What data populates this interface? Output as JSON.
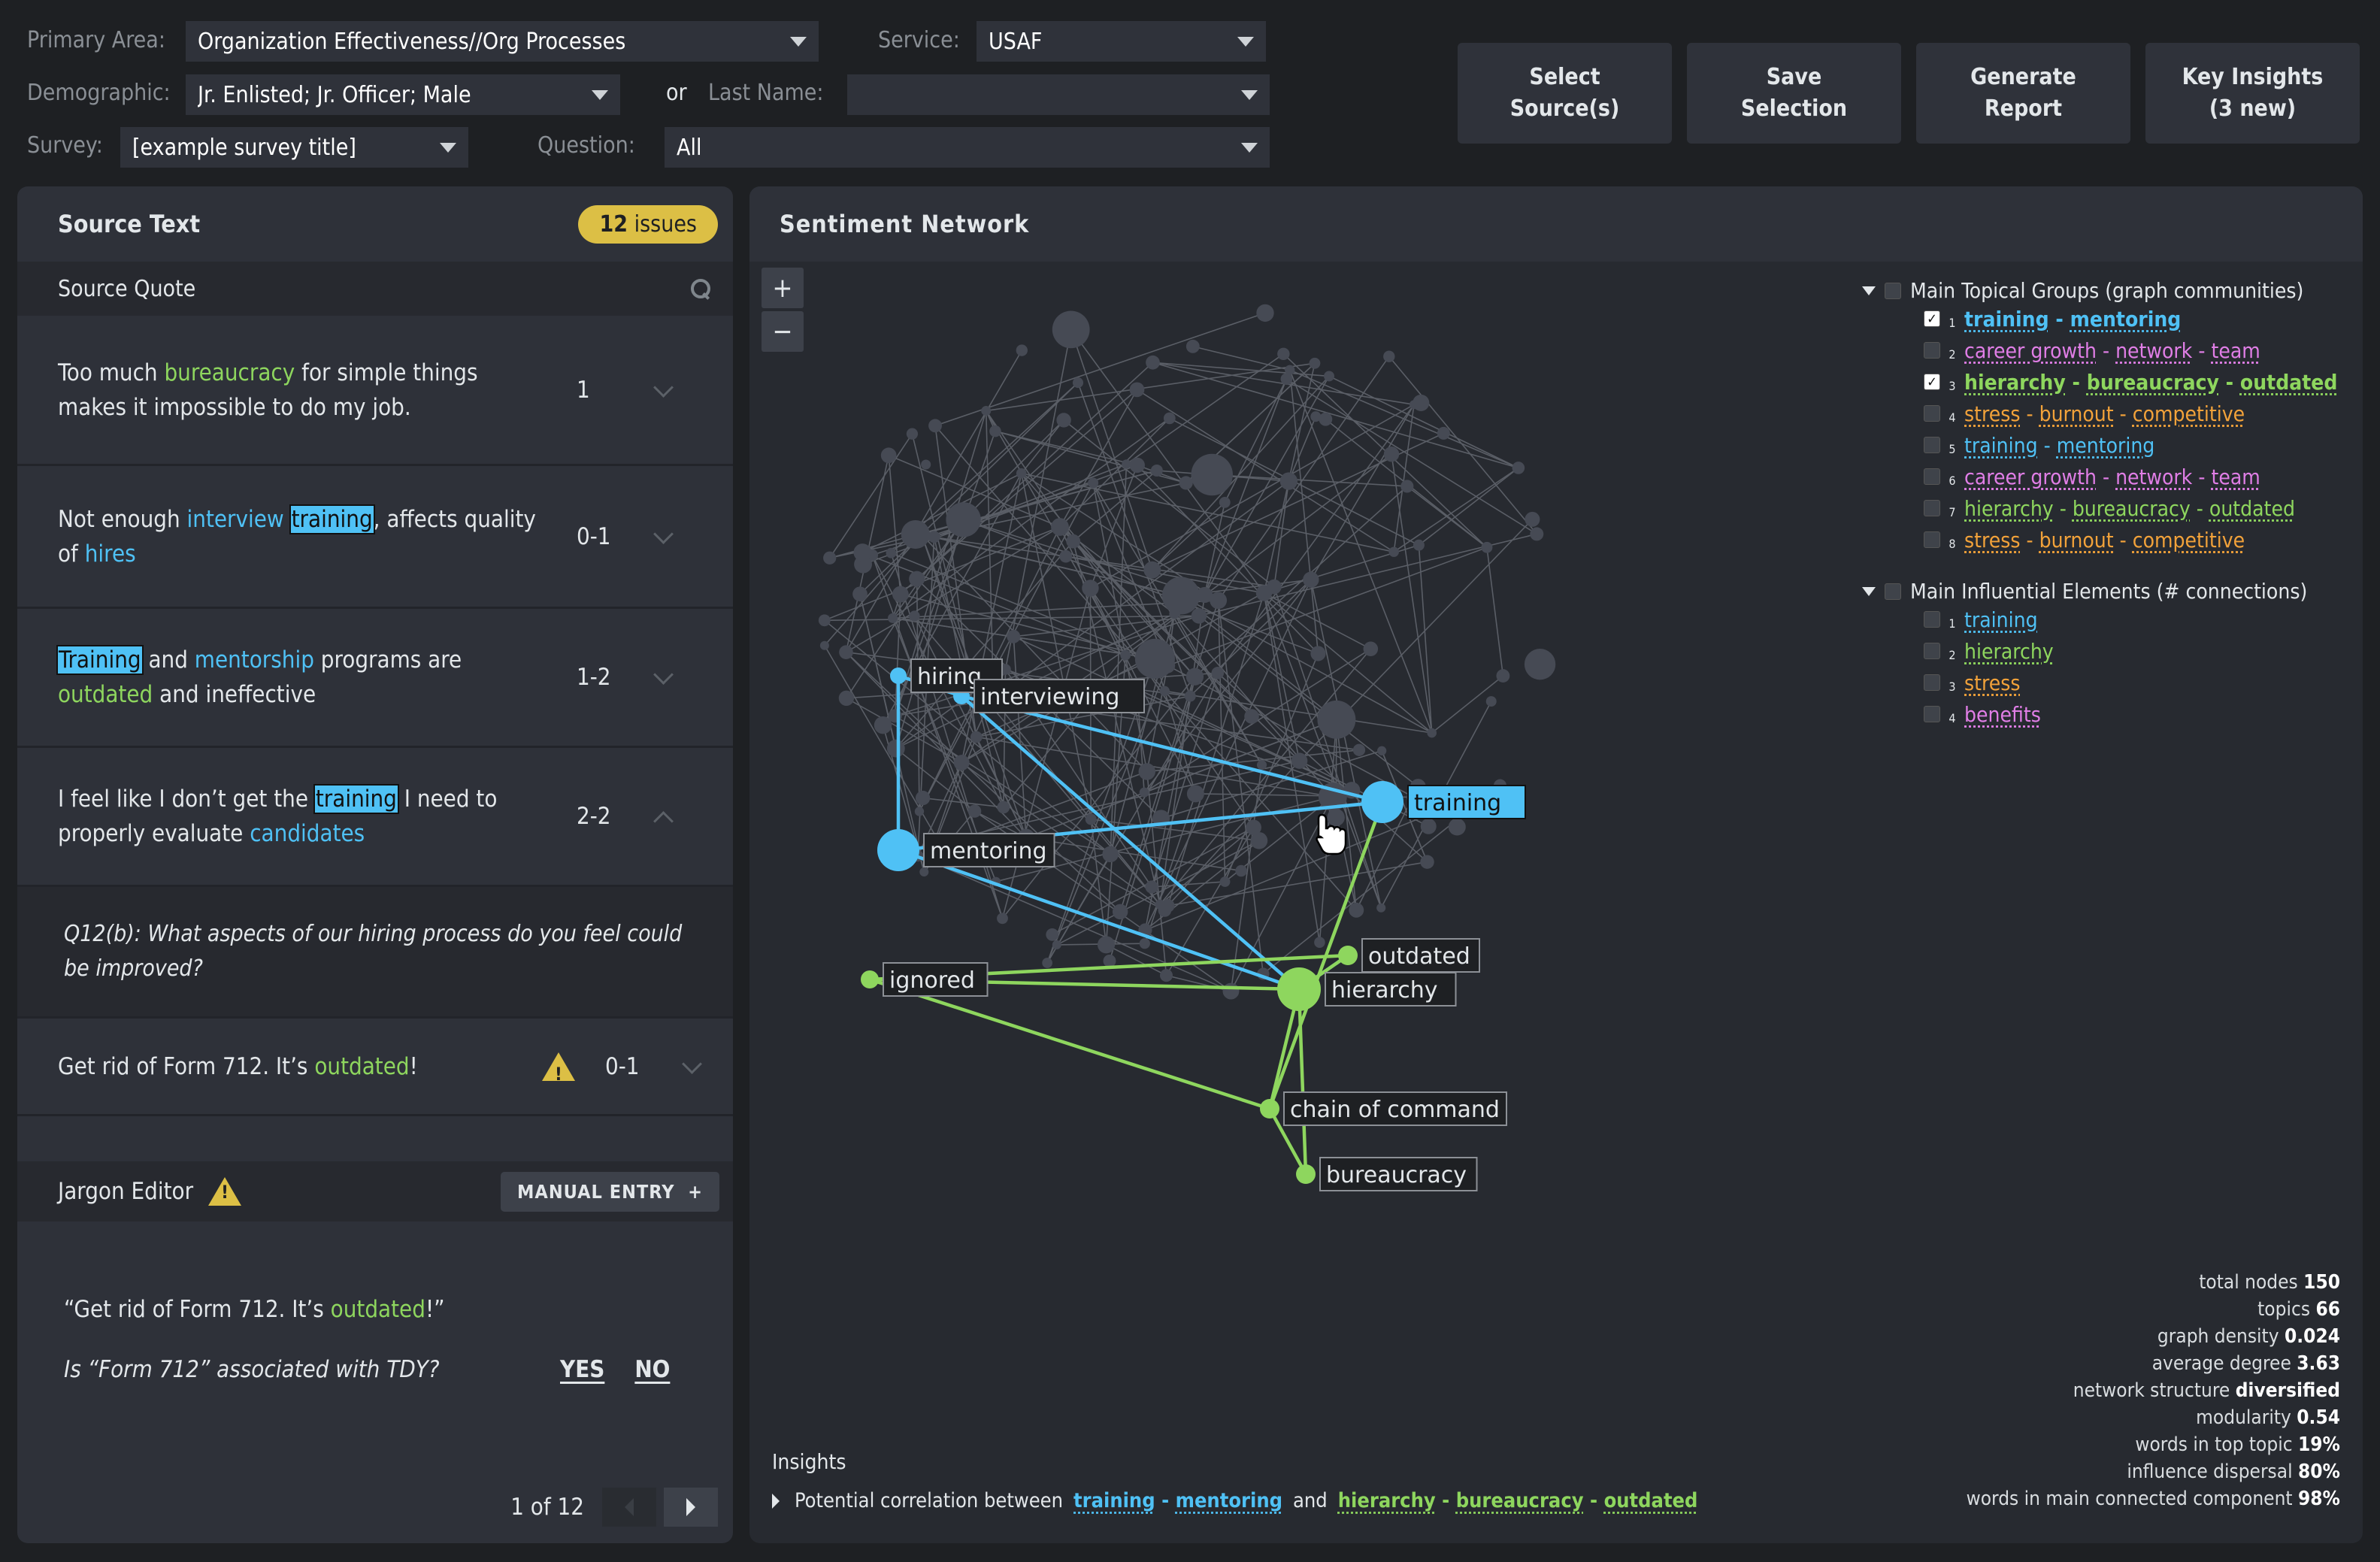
{
  "filters": {
    "primary_area": {
      "label": "Primary Area:",
      "value": "Organization Effectiveness//Org Processes"
    },
    "service": {
      "label": "Service:",
      "value": "USAF"
    },
    "demographic": {
      "label": "Demographic:",
      "value": "Jr. Enlisted; Jr. Officer; Male"
    },
    "or_label": "or",
    "last_name": {
      "label": "Last Name:",
      "value": ""
    },
    "survey": {
      "label": "Survey:",
      "value": "[example survey title]"
    },
    "question": {
      "label": "Question:",
      "value": "All"
    }
  },
  "actions": {
    "select_sources": "Select\nSource(s)",
    "save_selection": "Save\nSelection",
    "generate_report": "Generate\nReport",
    "key_insights": "Key Insights\n(3 new)"
  },
  "source_text": {
    "title": "Source Text",
    "issues_count": "12",
    "issues_label": "issues",
    "column_header": "Source Quote",
    "quotes": [
      {
        "parts": [
          [
            "Too much ",
            ""
          ],
          [
            "bureaucracy",
            "green"
          ],
          [
            " for simple things makes it impossible to do my job.",
            ""
          ]
        ],
        "score": "1",
        "expanded": false
      },
      {
        "parts": [
          [
            "Not enough ",
            ""
          ],
          [
            "interview",
            "blue"
          ],
          [
            " ",
            ""
          ],
          [
            "training",
            "box"
          ],
          [
            ", affects quality of ",
            ""
          ],
          [
            "hires",
            "blue"
          ]
        ],
        "score": "0-1",
        "expanded": false
      },
      {
        "parts": [
          [
            "Training",
            "box"
          ],
          [
            " and ",
            ""
          ],
          [
            "mentorship",
            "blue"
          ],
          [
            " programs are ",
            ""
          ],
          [
            "outdated",
            "green"
          ],
          [
            " and ineffective",
            ""
          ]
        ],
        "score": "1-2",
        "expanded": false
      },
      {
        "parts": [
          [
            "I feel like I don’t get the ",
            ""
          ],
          [
            "training",
            "box"
          ],
          [
            " I need to properly evaluate ",
            ""
          ],
          [
            "candidates",
            "blue"
          ]
        ],
        "score": "2-2",
        "expanded": true,
        "question": "Q12(b):  What aspects of our hiring process do you feel could be improved?"
      },
      {
        "parts": [
          [
            "Get rid of Form 712. It’s ",
            ""
          ],
          [
            "outdated",
            "green"
          ],
          [
            "!",
            ""
          ]
        ],
        "score": "0-1",
        "expanded": false,
        "warning": true
      }
    ]
  },
  "jargon_editor": {
    "title": "Jargon Editor",
    "manual_entry": "MANUAL ENTRY",
    "quote_parts": [
      [
        "“Get rid of Form 712. It’s ",
        ""
      ],
      [
        "outdated",
        "green"
      ],
      [
        "!”",
        ""
      ]
    ],
    "question": "Is “Form 712” associated with TDY?",
    "yes": "YES",
    "no": "NO",
    "pager": "1 of 12"
  },
  "network": {
    "title": "Sentiment Network",
    "zoom_in": "+",
    "zoom_out": "−",
    "colors": {
      "blue": "#4fc1f5",
      "green": "#8ed65e",
      "orange": "#f2a23a",
      "pink": "#e07ee6",
      "gray": "#464a54"
    },
    "highlighted_nodes": [
      {
        "id": "hiring",
        "label": "hiring",
        "group": "blue",
        "size": "small"
      },
      {
        "id": "interviewing",
        "label": "interviewing",
        "group": "blue",
        "size": "small"
      },
      {
        "id": "training",
        "label": "training",
        "group": "blue",
        "size": "large",
        "hovered": true
      },
      {
        "id": "mentoring",
        "label": "mentoring",
        "group": "blue",
        "size": "large"
      },
      {
        "id": "outdated",
        "label": "outdated",
        "group": "green",
        "size": "small"
      },
      {
        "id": "ignored",
        "label": "ignored",
        "group": "green",
        "size": "small"
      },
      {
        "id": "hierarchy",
        "label": "hierarchy",
        "group": "green",
        "size": "large"
      },
      {
        "id": "chain_of_command",
        "label": "chain of command",
        "group": "green",
        "size": "small"
      },
      {
        "id": "bureaucracy",
        "label": "bureaucracy",
        "group": "green",
        "size": "small"
      }
    ],
    "highlighted_edges": [
      [
        "hiring",
        "interviewing",
        "blue"
      ],
      [
        "hiring",
        "mentoring",
        "blue"
      ],
      [
        "interviewing",
        "training",
        "blue"
      ],
      [
        "interviewing",
        "hierarchy",
        "blue"
      ],
      [
        "mentoring",
        "training",
        "blue"
      ],
      [
        "mentoring",
        "hierarchy",
        "blue"
      ],
      [
        "hierarchy",
        "outdated",
        "blue"
      ],
      [
        "training",
        "chain_of_command",
        "green"
      ],
      [
        "ignored",
        "hierarchy",
        "green"
      ],
      [
        "ignored",
        "outdated",
        "green"
      ],
      [
        "ignored",
        "chain_of_command",
        "green"
      ],
      [
        "hierarchy",
        "chain_of_command",
        "green"
      ],
      [
        "hierarchy",
        "bureaucracy",
        "green"
      ],
      [
        "chain_of_command",
        "bureaucracy",
        "green"
      ],
      [
        "hierarchy",
        "outdated",
        "green"
      ]
    ],
    "topical_groups": {
      "header": "Main Topical Groups (graph communities)",
      "items": [
        {
          "n": "1",
          "terms": [
            "training",
            "mentoring"
          ],
          "color": "blue",
          "checked": true
        },
        {
          "n": "2",
          "terms": [
            "career growth",
            "network",
            "team"
          ],
          "color": "pink",
          "checked": false
        },
        {
          "n": "3",
          "terms": [
            "hierarchy",
            "bureaucracy",
            "outdated"
          ],
          "color": "green",
          "checked": true
        },
        {
          "n": "4",
          "terms": [
            "stress",
            "burnout",
            "competitive"
          ],
          "color": "orange",
          "checked": false
        },
        {
          "n": "5",
          "terms": [
            "training",
            "mentoring"
          ],
          "color": "blue",
          "checked": false
        },
        {
          "n": "6",
          "terms": [
            "career growth",
            "network",
            "team"
          ],
          "color": "pink",
          "checked": false
        },
        {
          "n": "7",
          "terms": [
            "hierarchy",
            "bureaucracy",
            "outdated"
          ],
          "color": "green",
          "checked": false
        },
        {
          "n": "8",
          "terms": [
            "stress",
            "burnout",
            "competitive"
          ],
          "color": "orange",
          "checked": false
        }
      ]
    },
    "influential": {
      "header": "Main Influential Elements (# connections)",
      "items": [
        {
          "n": "1",
          "term": "training",
          "color": "blue"
        },
        {
          "n": "2",
          "term": "hierarchy",
          "color": "green"
        },
        {
          "n": "3",
          "term": "stress",
          "color": "orange"
        },
        {
          "n": "4",
          "term": "benefits",
          "color": "pink"
        }
      ]
    },
    "stats": [
      {
        "label": "total nodes",
        "value": "150"
      },
      {
        "label": "topics",
        "value": "66"
      },
      {
        "label": "graph density",
        "value": "0.024"
      },
      {
        "label": "average degree",
        "value": "3.63"
      },
      {
        "label": "network structure",
        "value": "diversified"
      },
      {
        "label": "modularity",
        "value": "0.54"
      },
      {
        "label": "words in top topic",
        "value": "19%"
      },
      {
        "label": "influence dispersal",
        "value": "80%"
      },
      {
        "label": "words in main connected component",
        "value": "98%"
      }
    ],
    "insights": {
      "title": "Insights",
      "prefix": "Potential correlation between",
      "group_a": [
        "training",
        "mentoring"
      ],
      "conj": "and",
      "group_b": [
        "hierarchy",
        "bureaucracy",
        "outdated"
      ]
    }
  }
}
